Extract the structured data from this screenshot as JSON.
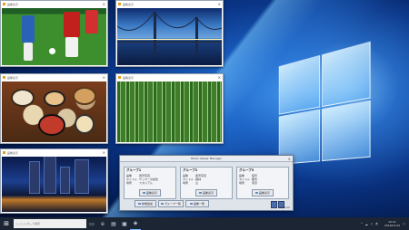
{
  "photo_windows": {
    "soccer": {
      "title": "画像表示"
    },
    "bridge": {
      "title": "画像表示"
    },
    "food": {
      "title": "画像表示"
    },
    "forest": {
      "title": "画像表示"
    },
    "city": {
      "title": "画像表示"
    }
  },
  "app_window": {
    "title": "Photo Viewer Manager",
    "groups": [
      {
        "title": "グループ1",
        "rows": [
          {
            "k": "画像",
            "v": "風景写真"
          },
          {
            "k": "タイトル",
            "v": "サッカーの試合"
          },
          {
            "k": "場所",
            "v": "スタジアム"
          }
        ],
        "button": "画像表示"
      },
      {
        "title": "グループ2",
        "rows": [
          {
            "k": "画像",
            "v": "風景写真"
          },
          {
            "k": "タイトル",
            "v": "森林"
          },
          {
            "k": "場所",
            "v": "山"
          }
        ],
        "button": "画像表示"
      },
      {
        "title": "グループ3",
        "rows": [
          {
            "k": "画像",
            "v": "夜景"
          },
          {
            "k": "タイトル",
            "v": "都市"
          },
          {
            "k": "場所",
            "v": "東京"
          }
        ],
        "button": "画像表示"
      }
    ],
    "buttons": {
      "add": "新規追加",
      "group": "グループ一覧",
      "images": "画像一覧"
    },
    "version": "Ver 1.0.0"
  },
  "taskbar": {
    "search_placeholder": "ここに入力して検索",
    "tray": {
      "time": "10:11",
      "date": "2018/01/10"
    }
  },
  "icons": [
    "windows-logo-icon",
    "task-view-icon",
    "edge-icon",
    "folder-icon",
    "store-icon",
    "app-icon"
  ]
}
